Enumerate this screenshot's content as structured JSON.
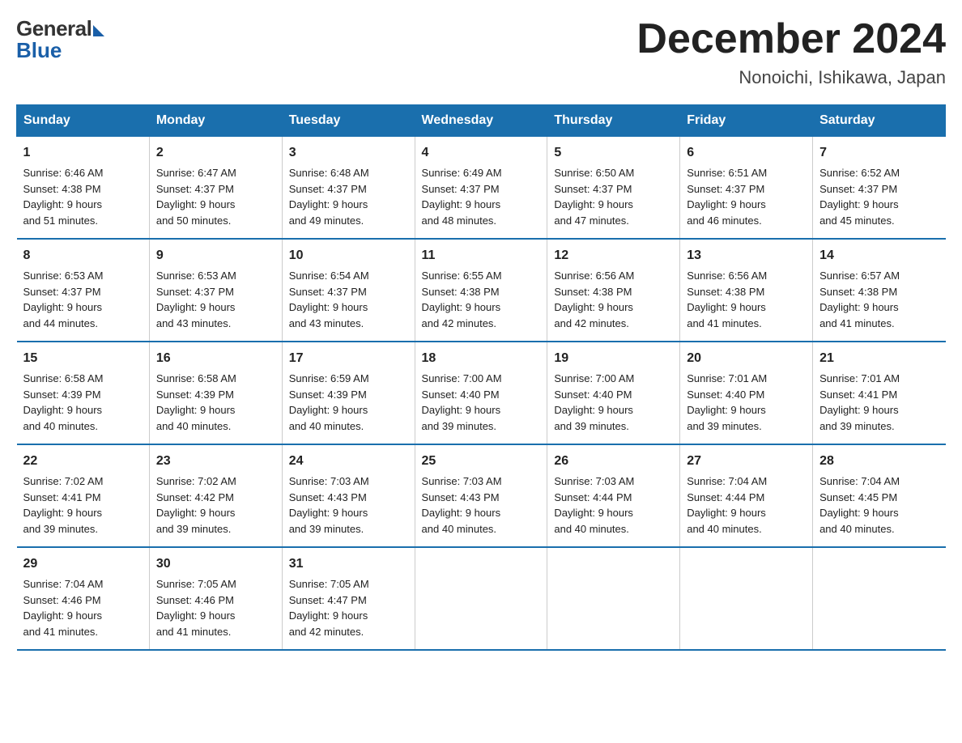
{
  "logo": {
    "general_text": "General",
    "blue_text": "Blue"
  },
  "title": "December 2024",
  "subtitle": "Nonoichi, Ishikawa, Japan",
  "days_of_week": [
    "Sunday",
    "Monday",
    "Tuesday",
    "Wednesday",
    "Thursday",
    "Friday",
    "Saturday"
  ],
  "weeks": [
    [
      {
        "day": "1",
        "sunrise": "6:46 AM",
        "sunset": "4:38 PM",
        "daylight": "9 hours and 51 minutes."
      },
      {
        "day": "2",
        "sunrise": "6:47 AM",
        "sunset": "4:37 PM",
        "daylight": "9 hours and 50 minutes."
      },
      {
        "day": "3",
        "sunrise": "6:48 AM",
        "sunset": "4:37 PM",
        "daylight": "9 hours and 49 minutes."
      },
      {
        "day": "4",
        "sunrise": "6:49 AM",
        "sunset": "4:37 PM",
        "daylight": "9 hours and 48 minutes."
      },
      {
        "day": "5",
        "sunrise": "6:50 AM",
        "sunset": "4:37 PM",
        "daylight": "9 hours and 47 minutes."
      },
      {
        "day": "6",
        "sunrise": "6:51 AM",
        "sunset": "4:37 PM",
        "daylight": "9 hours and 46 minutes."
      },
      {
        "day": "7",
        "sunrise": "6:52 AM",
        "sunset": "4:37 PM",
        "daylight": "9 hours and 45 minutes."
      }
    ],
    [
      {
        "day": "8",
        "sunrise": "6:53 AM",
        "sunset": "4:37 PM",
        "daylight": "9 hours and 44 minutes."
      },
      {
        "day": "9",
        "sunrise": "6:53 AM",
        "sunset": "4:37 PM",
        "daylight": "9 hours and 43 minutes."
      },
      {
        "day": "10",
        "sunrise": "6:54 AM",
        "sunset": "4:37 PM",
        "daylight": "9 hours and 43 minutes."
      },
      {
        "day": "11",
        "sunrise": "6:55 AM",
        "sunset": "4:38 PM",
        "daylight": "9 hours and 42 minutes."
      },
      {
        "day": "12",
        "sunrise": "6:56 AM",
        "sunset": "4:38 PM",
        "daylight": "9 hours and 42 minutes."
      },
      {
        "day": "13",
        "sunrise": "6:56 AM",
        "sunset": "4:38 PM",
        "daylight": "9 hours and 41 minutes."
      },
      {
        "day": "14",
        "sunrise": "6:57 AM",
        "sunset": "4:38 PM",
        "daylight": "9 hours and 41 minutes."
      }
    ],
    [
      {
        "day": "15",
        "sunrise": "6:58 AM",
        "sunset": "4:39 PM",
        "daylight": "9 hours and 40 minutes."
      },
      {
        "day": "16",
        "sunrise": "6:58 AM",
        "sunset": "4:39 PM",
        "daylight": "9 hours and 40 minutes."
      },
      {
        "day": "17",
        "sunrise": "6:59 AM",
        "sunset": "4:39 PM",
        "daylight": "9 hours and 40 minutes."
      },
      {
        "day": "18",
        "sunrise": "7:00 AM",
        "sunset": "4:40 PM",
        "daylight": "9 hours and 39 minutes."
      },
      {
        "day": "19",
        "sunrise": "7:00 AM",
        "sunset": "4:40 PM",
        "daylight": "9 hours and 39 minutes."
      },
      {
        "day": "20",
        "sunrise": "7:01 AM",
        "sunset": "4:40 PM",
        "daylight": "9 hours and 39 minutes."
      },
      {
        "day": "21",
        "sunrise": "7:01 AM",
        "sunset": "4:41 PM",
        "daylight": "9 hours and 39 minutes."
      }
    ],
    [
      {
        "day": "22",
        "sunrise": "7:02 AM",
        "sunset": "4:41 PM",
        "daylight": "9 hours and 39 minutes."
      },
      {
        "day": "23",
        "sunrise": "7:02 AM",
        "sunset": "4:42 PM",
        "daylight": "9 hours and 39 minutes."
      },
      {
        "day": "24",
        "sunrise": "7:03 AM",
        "sunset": "4:43 PM",
        "daylight": "9 hours and 39 minutes."
      },
      {
        "day": "25",
        "sunrise": "7:03 AM",
        "sunset": "4:43 PM",
        "daylight": "9 hours and 40 minutes."
      },
      {
        "day": "26",
        "sunrise": "7:03 AM",
        "sunset": "4:44 PM",
        "daylight": "9 hours and 40 minutes."
      },
      {
        "day": "27",
        "sunrise": "7:04 AM",
        "sunset": "4:44 PM",
        "daylight": "9 hours and 40 minutes."
      },
      {
        "day": "28",
        "sunrise": "7:04 AM",
        "sunset": "4:45 PM",
        "daylight": "9 hours and 40 minutes."
      }
    ],
    [
      {
        "day": "29",
        "sunrise": "7:04 AM",
        "sunset": "4:46 PM",
        "daylight": "9 hours and 41 minutes."
      },
      {
        "day": "30",
        "sunrise": "7:05 AM",
        "sunset": "4:46 PM",
        "daylight": "9 hours and 41 minutes."
      },
      {
        "day": "31",
        "sunrise": "7:05 AM",
        "sunset": "4:47 PM",
        "daylight": "9 hours and 42 minutes."
      },
      null,
      null,
      null,
      null
    ]
  ]
}
